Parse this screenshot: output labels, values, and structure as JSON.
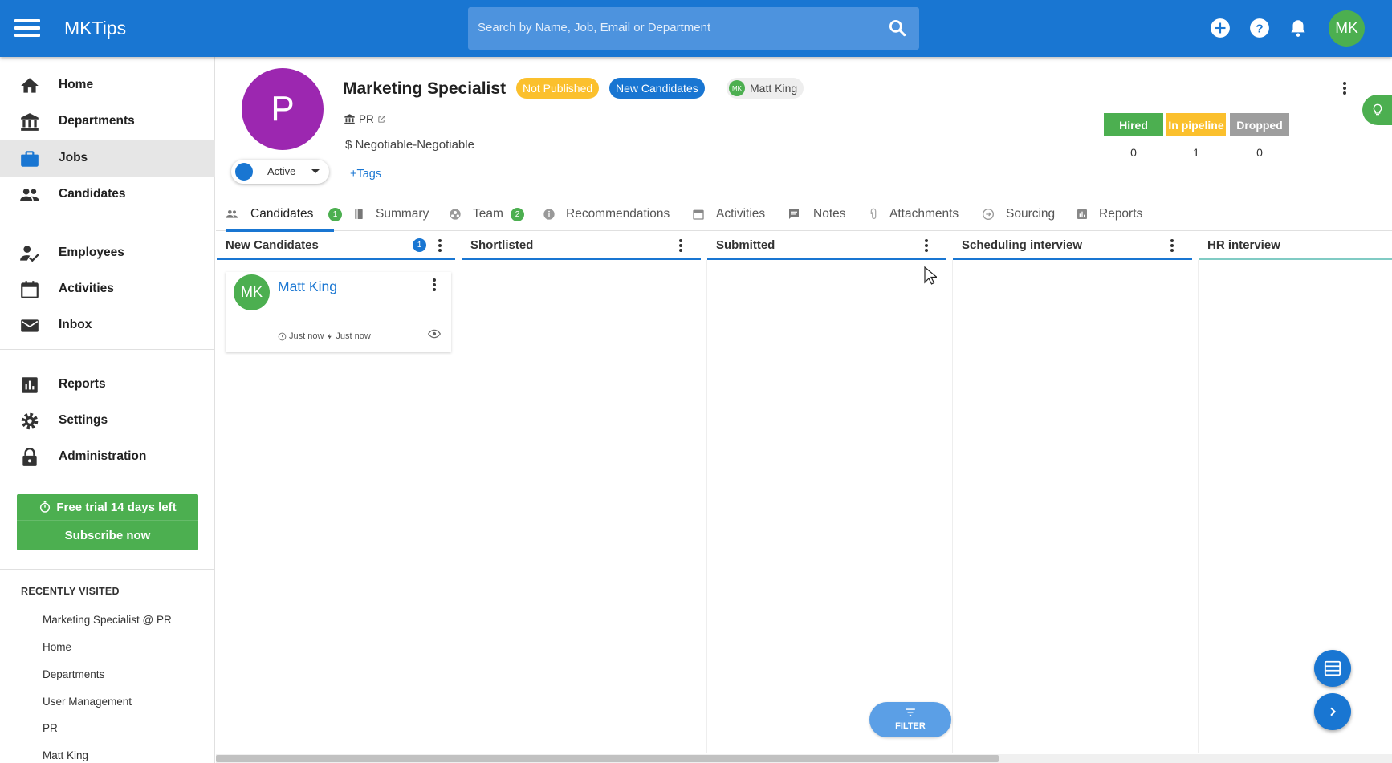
{
  "app": {
    "title": "MKTips",
    "user_initials": "MK"
  },
  "search": {
    "placeholder": "Search by Name, Job, Email or Department"
  },
  "sidebar": {
    "items": [
      {
        "label": "Home",
        "icon": "home-icon"
      },
      {
        "label": "Departments",
        "icon": "bank-icon"
      },
      {
        "label": "Jobs",
        "icon": "briefcase-icon",
        "active": true
      },
      {
        "label": "Candidates",
        "icon": "people-icon"
      },
      {
        "label": "Employees",
        "icon": "person-check-icon"
      },
      {
        "label": "Activities",
        "icon": "calendar-icon"
      },
      {
        "label": "Inbox",
        "icon": "mail-icon"
      },
      {
        "label": "Reports",
        "icon": "bar-chart-icon"
      },
      {
        "label": "Settings",
        "icon": "gear-icon"
      },
      {
        "label": "Administration",
        "icon": "lock-icon"
      }
    ],
    "trial": {
      "text": "Free trial 14 days left",
      "cta": "Subscribe now"
    },
    "recent_title": "RECENTLY VISITED",
    "recent": [
      "Marketing Specialist @ PR",
      "Home",
      "Departments",
      "User Management",
      "PR",
      "Matt King"
    ]
  },
  "job": {
    "avatar_letter": "P",
    "title": "Marketing Specialist",
    "publish_status": "Not Published",
    "stage_badge": "New Candidates",
    "owner": {
      "initials": "MK",
      "name": "Matt King"
    },
    "department": "PR",
    "salary": "Negotiable-Negotiable",
    "status": "Active",
    "tags_link": "+Tags"
  },
  "stats": [
    {
      "label": "Hired",
      "value": "0",
      "color": "#4caf50"
    },
    {
      "label": "In pipeline",
      "value": "1",
      "color": "#fbc02d"
    },
    {
      "label": "Dropped",
      "value": "0",
      "color": "#9e9e9e"
    }
  ],
  "tabs": [
    {
      "label": "Candidates",
      "count": "1",
      "active": true
    },
    {
      "label": "Summary"
    },
    {
      "label": "Team",
      "count": "2"
    },
    {
      "label": "Recommendations"
    },
    {
      "label": "Activities"
    },
    {
      "label": "Notes"
    },
    {
      "label": "Attachments"
    },
    {
      "label": "Sourcing"
    },
    {
      "label": "Reports"
    }
  ],
  "columns": [
    {
      "label": "New Candidates",
      "count": "1"
    },
    {
      "label": "Shortlisted"
    },
    {
      "label": "Submitted"
    },
    {
      "label": "Scheduling interview"
    },
    {
      "label": "HR interview"
    }
  ],
  "card": {
    "initials": "MK",
    "name": "Matt King",
    "created": "Just now",
    "updated": "Just now"
  },
  "filter_label": "FILTER",
  "colors": {
    "primary": "#1976d2",
    "success": "#4caf50",
    "warning": "#fbc02d",
    "job_avatar": "#9c27b0"
  }
}
